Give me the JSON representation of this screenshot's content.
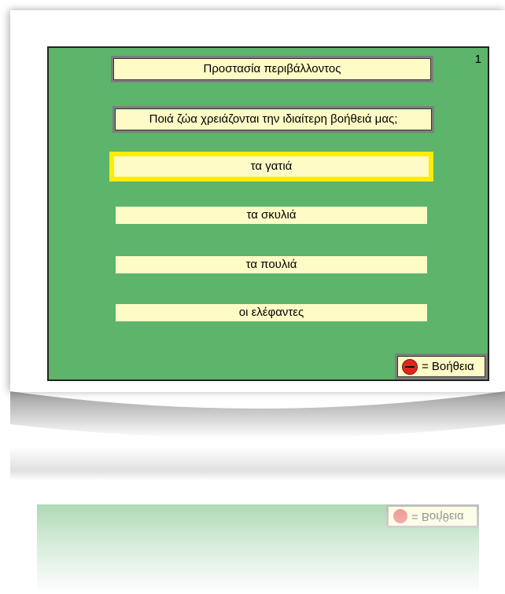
{
  "slide": {
    "number": "1",
    "title": "Προστασία περιβάλλοντος",
    "question": "Ποιά ζώα χρειάζονται την ιδιαίτερη βοήθειά μας;",
    "answers": [
      {
        "label": "τα γατιά",
        "selected": true
      },
      {
        "label": "τα σκυλιά",
        "selected": false
      },
      {
        "label": "τα πουλιά",
        "selected": false
      },
      {
        "label": "οι ελέφαντες",
        "selected": false
      }
    ],
    "help": {
      "icon": "help-circle-icon",
      "label": "= Βοήθεια"
    }
  },
  "colors": {
    "background": "#5db46b",
    "box": "#fffbc6",
    "selection": "#ffec00",
    "help_icon": "#e0271f"
  }
}
